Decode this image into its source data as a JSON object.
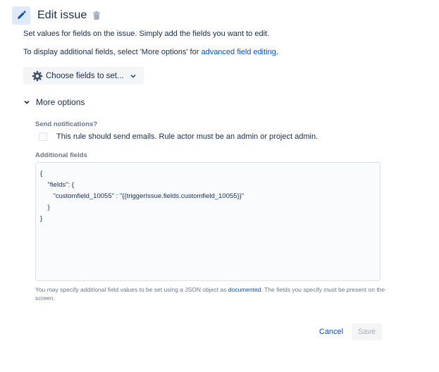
{
  "header": {
    "icon": "pencil-icon",
    "title": "Edit issue",
    "delete_icon": "trash-icon"
  },
  "description": {
    "line1": "Set values for fields on the issue. Simply add the fields you want to edit.",
    "line2_prefix": "To display additional fields, select 'More options' for ",
    "line2_link": "advanced field editing",
    "line2_suffix": "."
  },
  "choose_fields": {
    "icon": "gear-icon",
    "label": "Choose fields to set...",
    "chevron": "chevron-down-icon"
  },
  "more_options": {
    "label": "More options",
    "expanded": true
  },
  "notifications": {
    "label": "Send notifications?",
    "checkbox_label": "This rule should send emails. Rule actor must be an admin or project admin.",
    "checked": false
  },
  "additional_fields": {
    "label": "Additional fields",
    "value": "{\n    \"fields\": {\n       \"customfield_10055\" : \"{{triggerIssue.fields.customfield_10055}}\"\n    }\n}"
  },
  "help": {
    "prefix": "You may specify additional field values to be set using a JSON object as ",
    "link": "documented",
    "suffix": ". The fields you specify must be present on the screen."
  },
  "actions": {
    "cancel": "Cancel",
    "save": "Save"
  },
  "colors": {
    "link": "#0052cc",
    "icon_bg": "#deebff",
    "button_bg": "#f4f5f7",
    "disabled_text": "#a5adba"
  }
}
